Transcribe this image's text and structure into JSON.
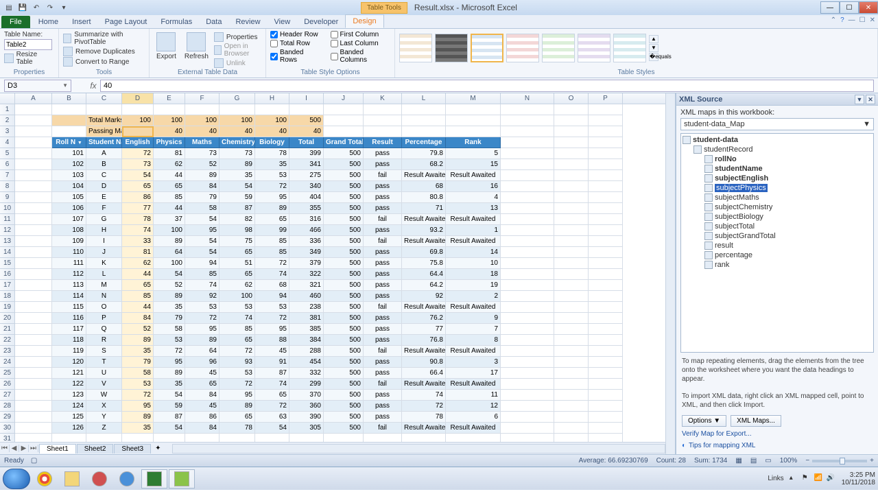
{
  "title": "Result.xlsx - Microsoft Excel",
  "tabletools": "Table Tools",
  "ribbon_tabs": [
    "File",
    "Home",
    "Insert",
    "Page Layout",
    "Formulas",
    "Data",
    "Review",
    "View",
    "Developer",
    "Design"
  ],
  "active_tab": "Design",
  "properties": {
    "label_name": "Table Name:",
    "name_value": "Table2",
    "resize": "Resize Table",
    "group": "Properties"
  },
  "tools": {
    "pivot": "Summarize with PivotTable",
    "dup": "Remove Duplicates",
    "range": "Convert to Range",
    "group": "Tools"
  },
  "extdata": {
    "export": "Export",
    "refresh": "Refresh",
    "props": "Properties",
    "open": "Open in Browser",
    "unlink": "Unlink",
    "group": "External Table Data"
  },
  "styleopts": {
    "hr": "Header Row",
    "tr": "Total Row",
    "br": "Banded Rows",
    "fc": "First Column",
    "lc": "Last Column",
    "bc": "Banded Columns",
    "group": "Table Style Options"
  },
  "tstyles_group": "Table Styles",
  "name_box": "D3",
  "formula_value": "40",
  "columns": [
    "A",
    "B",
    "C",
    "D",
    "E",
    "F",
    "G",
    "H",
    "I",
    "J",
    "K",
    "L",
    "M",
    "N",
    "O",
    "P"
  ],
  "row2": {
    "label": "Total Marks",
    "vals": [
      100,
      100,
      100,
      100,
      100,
      500
    ]
  },
  "row3": {
    "label": "Passing Marks",
    "vals": [
      "",
      40,
      40,
      40,
      40,
      40
    ]
  },
  "headers": [
    "Roll N",
    "Student Name",
    "English",
    "Physics",
    "Maths",
    "Chemistry",
    "Biology",
    "Total",
    "Grand Total",
    "Result",
    "Percentage",
    "Rank"
  ],
  "data": [
    [
      101,
      "A",
      72,
      81,
      73,
      73,
      78,
      399,
      500,
      "pass",
      "79.8",
      5
    ],
    [
      102,
      "B",
      73,
      62,
      52,
      89,
      35,
      341,
      500,
      "pass",
      "68.2",
      15
    ],
    [
      103,
      "C",
      54,
      44,
      89,
      35,
      53,
      275,
      500,
      "fail",
      "Result Awaited",
      "Result Awaited"
    ],
    [
      104,
      "D",
      65,
      65,
      84,
      54,
      72,
      340,
      500,
      "pass",
      "68",
      16
    ],
    [
      105,
      "E",
      86,
      85,
      79,
      59,
      95,
      404,
      500,
      "pass",
      "80.8",
      4
    ],
    [
      106,
      "F",
      77,
      44,
      58,
      87,
      89,
      355,
      500,
      "pass",
      "71",
      13
    ],
    [
      107,
      "G",
      78,
      37,
      54,
      82,
      65,
      316,
      500,
      "fail",
      "Result Awaited",
      "Result Awaited"
    ],
    [
      108,
      "H",
      74,
      100,
      95,
      98,
      99,
      466,
      500,
      "pass",
      "93.2",
      1
    ],
    [
      109,
      "I",
      33,
      89,
      54,
      75,
      85,
      336,
      500,
      "fail",
      "Result Awaited",
      "Result Awaited"
    ],
    [
      110,
      "J",
      81,
      64,
      54,
      65,
      85,
      349,
      500,
      "pass",
      "69.8",
      14
    ],
    [
      111,
      "K",
      62,
      100,
      94,
      51,
      72,
      379,
      500,
      "pass",
      "75.8",
      10
    ],
    [
      112,
      "L",
      44,
      54,
      85,
      65,
      74,
      322,
      500,
      "pass",
      "64.4",
      18
    ],
    [
      113,
      "M",
      65,
      52,
      74,
      62,
      68,
      321,
      500,
      "pass",
      "64.2",
      19
    ],
    [
      114,
      "N",
      85,
      89,
      92,
      100,
      94,
      460,
      500,
      "pass",
      "92",
      2
    ],
    [
      115,
      "O",
      44,
      35,
      53,
      53,
      53,
      238,
      500,
      "fail",
      "Result Awaited",
      "Result Awaited"
    ],
    [
      116,
      "P",
      84,
      79,
      72,
      74,
      72,
      381,
      500,
      "pass",
      "76.2",
      9
    ],
    [
      117,
      "Q",
      52,
      58,
      95,
      85,
      95,
      385,
      500,
      "pass",
      "77",
      7
    ],
    [
      118,
      "R",
      89,
      53,
      89,
      65,
      88,
      384,
      500,
      "pass",
      "76.8",
      8
    ],
    [
      119,
      "S",
      35,
      72,
      64,
      72,
      45,
      288,
      500,
      "fail",
      "Result Awaited",
      "Result Awaited"
    ],
    [
      120,
      "T",
      79,
      95,
      96,
      93,
      91,
      454,
      500,
      "pass",
      "90.8",
      3
    ],
    [
      121,
      "U",
      58,
      89,
      45,
      53,
      87,
      332,
      500,
      "pass",
      "66.4",
      17
    ],
    [
      122,
      "V",
      53,
      35,
      65,
      72,
      74,
      299,
      500,
      "fail",
      "Result Awaited",
      "Result Awaited"
    ],
    [
      123,
      "W",
      72,
      54,
      84,
      95,
      65,
      370,
      500,
      "pass",
      "74",
      11
    ],
    [
      124,
      "X",
      95,
      59,
      45,
      89,
      72,
      360,
      500,
      "pass",
      "72",
      12
    ],
    [
      125,
      "Y",
      89,
      87,
      86,
      65,
      63,
      390,
      500,
      "pass",
      "78",
      6
    ],
    [
      126,
      "Z",
      35,
      54,
      84,
      78,
      54,
      305,
      500,
      "fail",
      "Result Awaited",
      "Result Awaited"
    ]
  ],
  "sheets": [
    "Sheet1",
    "Sheet2",
    "Sheet3"
  ],
  "xml": {
    "title": "XML Source",
    "maps_label": "XML maps in this workbook:",
    "map_name": "student-data_Map",
    "root": "student-data",
    "record": "studentRecord",
    "fields": [
      "rollNo",
      "studentName",
      "subjectEnglish",
      "subjectPhysics",
      "subjectMaths",
      "subjectChemistry",
      "subjectBiology",
      "subjectTotal",
      "subjectGrandTotal",
      "result",
      "percentage",
      "rank"
    ],
    "selected": "subjectPhysics",
    "hint1": "To map repeating elements, drag the elements from the tree onto the worksheet where you want the data headings to appear.",
    "hint2": "To import XML data, right click an XML mapped cell, point to XML, and then click Import.",
    "options": "Options",
    "xml_maps": "XML Maps...",
    "verify": "Verify Map for Export...",
    "tips": "Tips for mapping XML"
  },
  "status": {
    "ready": "Ready",
    "avg": "Average: 66.69230769",
    "count": "Count: 28",
    "sum": "Sum: 1734",
    "zoom": "100%",
    "links": "Links"
  },
  "clock": {
    "time": "3:25 PM",
    "date": "10/11/2018"
  }
}
